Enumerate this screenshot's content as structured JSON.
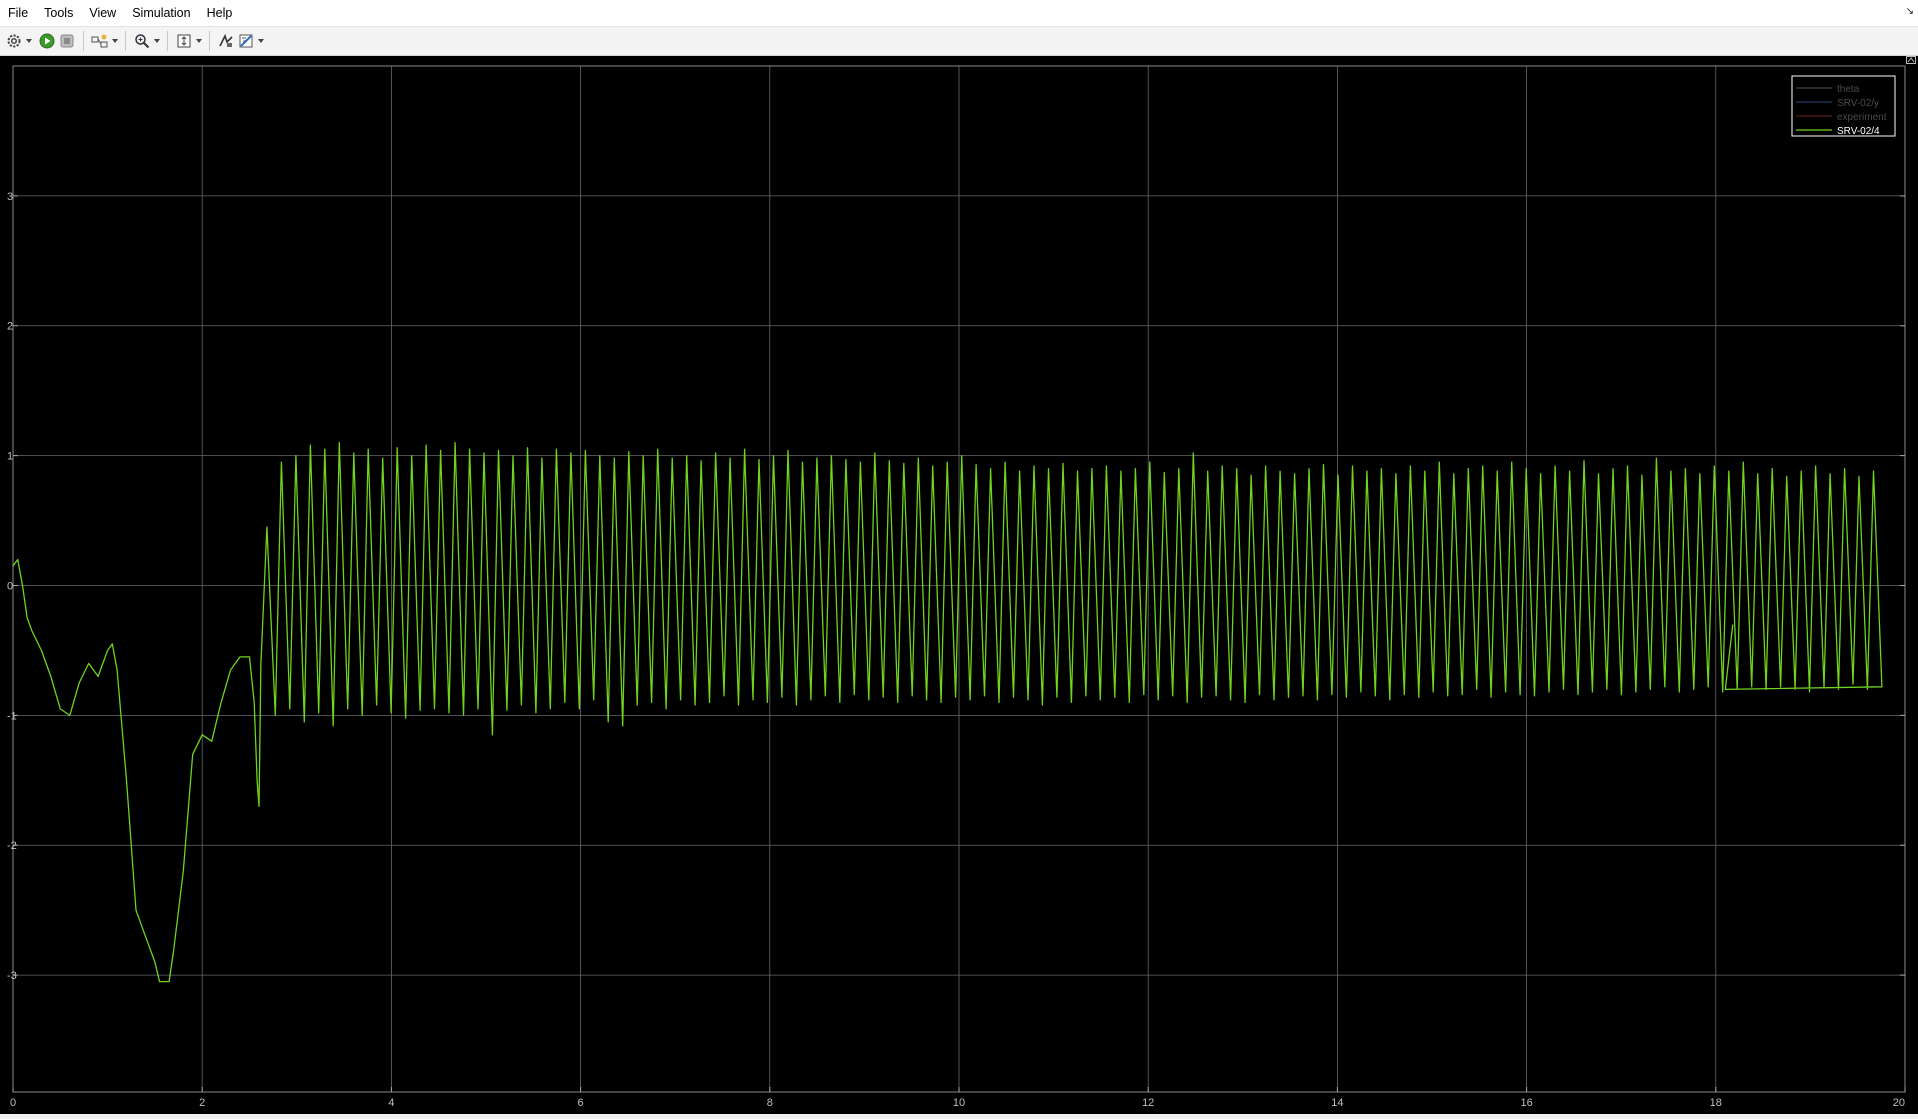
{
  "menu": [
    "File",
    "Tools",
    "View",
    "Simulation",
    "Help"
  ],
  "toolbar": {
    "icons": [
      "settings-icon",
      "run-icon",
      "stop-icon",
      "highlight-block-icon",
      "zoom-icon",
      "autoscale-icon",
      "trigger-icon",
      "measure-icon"
    ]
  },
  "colors": {
    "background": "#000000",
    "grid": "#686868",
    "axis_text": "#bfbfbf",
    "signal": "#6fd320",
    "legend_border": "#ffffff"
  },
  "chart_data": {
    "type": "line",
    "xlim": [
      0,
      20
    ],
    "ylim": [
      -3.9,
      4
    ],
    "xticks": [
      "0",
      "2",
      "4",
      "6",
      "8",
      "10",
      "12",
      "14",
      "16",
      "18",
      "20"
    ],
    "yticks": [
      "-3",
      "-2",
      "-1",
      "0",
      "1",
      "2",
      "3"
    ],
    "grid": true,
    "legend_position": "top-right",
    "legend": [
      {
        "name": "theta",
        "color": "#404040"
      },
      {
        "name": "SRV-02/y",
        "color": "#1f3a60"
      },
      {
        "name": "experiment",
        "color": "#5a1d1d"
      },
      {
        "name": "SRV-02/4",
        "color": "#6fd320"
      }
    ],
    "series": [
      {
        "name": "SRV-02/4",
        "color": "#6fd320",
        "transient": {
          "x": [
            0,
            0.05,
            0.1,
            0.15,
            0.2,
            0.3,
            0.4,
            0.5,
            0.6,
            0.7,
            0.8,
            0.9,
            1.0,
            1.05,
            1.1,
            1.2,
            1.3,
            1.4,
            1.5,
            1.55,
            1.65,
            1.7,
            1.8,
            1.9,
            2.0,
            2.1,
            2.2,
            2.3,
            2.4,
            2.5,
            2.55,
            2.58,
            2.6,
            2.62
          ],
          "y": [
            0.15,
            0.2,
            0.0,
            -0.25,
            -0.35,
            -0.5,
            -0.7,
            -0.95,
            -1.0,
            -0.75,
            -0.6,
            -0.7,
            -0.5,
            -0.45,
            -0.65,
            -1.5,
            -2.5,
            -2.7,
            -2.9,
            -3.05,
            -3.05,
            -2.8,
            -2.2,
            -1.3,
            -1.15,
            -1.2,
            -0.9,
            -0.65,
            -0.55,
            -0.55,
            -0.9,
            -1.5,
            -1.7,
            -0.6
          ]
        },
        "oscillation": {
          "start": 2.62,
          "end": 18.1,
          "period": 0.153,
          "peaks": [
            0.45,
            0.95,
            1.0,
            1.08,
            1.05,
            1.1,
            1.02,
            1.05,
            0.98,
            1.06,
            1.0,
            1.08,
            1.04,
            1.1,
            1.05,
            1.02,
            1.04,
            1.0,
            1.06,
            0.98,
            1.05,
            1.02,
            1.04,
            1.0,
            0.98,
            1.03,
            1.0,
            1.05,
            0.98,
            1.0,
            0.96,
            1.02,
            0.98,
            1.05,
            0.97,
            1.0,
            1.04,
            0.95,
            0.98,
            1.0,
            0.97,
            0.95,
            1.02,
            0.96,
            0.94,
            0.98,
            0.92,
            0.95,
            1.0,
            0.93,
            0.9,
            0.95,
            0.88,
            0.92,
            0.9,
            0.94,
            0.88,
            0.9,
            0.92,
            0.88,
            0.9,
            0.95,
            0.87,
            0.9,
            1.02,
            0.88,
            0.92,
            0.9,
            0.85,
            0.92,
            0.88,
            0.86,
            0.9,
            0.93,
            0.85,
            0.92,
            0.88,
            0.9,
            0.86,
            0.92,
            0.88,
            0.95,
            0.86,
            0.9,
            0.92,
            0.88,
            0.95,
            0.9,
            0.86,
            0.92,
            0.88,
            0.96,
            0.86,
            0.9,
            0.92,
            0.85,
            0.98,
            0.88,
            0.9,
            0.86,
            0.92,
            0.88,
            0.95,
            0.86,
            0.9,
            0.84,
            0.88,
            0.92,
            0.86,
            0.9,
            0.84,
            0.88
          ],
          "troughs": [
            -1.0,
            -0.95,
            -1.05,
            -0.98,
            -1.08,
            -0.95,
            -1.0,
            -0.92,
            -0.98,
            -1.02,
            -0.96,
            -0.95,
            -0.98,
            -1.0,
            -0.95,
            -1.15,
            -0.96,
            -0.92,
            -0.98,
            -0.95,
            -0.9,
            -0.95,
            -0.88,
            -1.05,
            -1.08,
            -0.92,
            -0.9,
            -0.95,
            -0.88,
            -0.92,
            -0.9,
            -0.85,
            -0.92,
            -0.88,
            -0.9,
            -0.86,
            -0.92,
            -0.88,
            -0.85,
            -0.9,
            -0.84,
            -0.88,
            -0.86,
            -0.9,
            -0.85,
            -0.88,
            -0.9,
            -0.86,
            -0.88,
            -0.85,
            -0.9,
            -0.86,
            -0.88,
            -0.92,
            -0.86,
            -0.9,
            -0.85,
            -0.88,
            -0.86,
            -0.9,
            -0.84,
            -0.88,
            -0.85,
            -0.9,
            -0.86,
            -0.85,
            -0.88,
            -0.9,
            -0.84,
            -0.88,
            -0.86,
            -0.85,
            -0.88,
            -0.84,
            -0.86,
            -0.82,
            -0.85,
            -0.88,
            -0.84,
            -0.86,
            -0.82,
            -0.85,
            -0.84,
            -0.8,
            -0.86,
            -0.82,
            -0.84,
            -0.85,
            -0.82,
            -0.8,
            -0.84,
            -0.82,
            -0.8,
            -0.84,
            -0.82,
            -0.8,
            -0.78,
            -0.82,
            -0.8,
            -0.78,
            -0.82,
            -0.8,
            -0.78,
            -0.8,
            -0.78,
            -0.8,
            -0.82,
            -0.78,
            -0.8,
            -0.76,
            -0.8,
            -0.78
          ]
        },
        "tail": {
          "x": [
            18.1,
            18.18
          ],
          "y": [
            -0.8,
            -0.3
          ]
        }
      }
    ]
  }
}
